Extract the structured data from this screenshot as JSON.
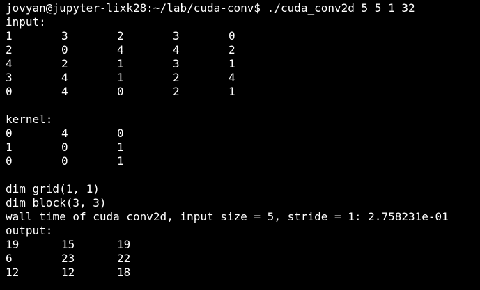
{
  "prompt": {
    "user_host_path": "jovyan@jupyter-lixk28:~/lab/cuda-conv$",
    "command": " ./cuda_conv2d 5 5 1 32"
  },
  "input": {
    "label": "input:",
    "rows": [
      [
        "1",
        "3",
        "2",
        "3",
        "0"
      ],
      [
        "2",
        "0",
        "4",
        "4",
        "2"
      ],
      [
        "4",
        "2",
        "1",
        "3",
        "1"
      ],
      [
        "3",
        "4",
        "1",
        "2",
        "4"
      ],
      [
        "0",
        "4",
        "0",
        "2",
        "1"
      ]
    ]
  },
  "kernel": {
    "label": "kernel:",
    "rows": [
      [
        "0",
        "4",
        "0"
      ],
      [
        "1",
        "0",
        "1"
      ],
      [
        "0",
        "0",
        "1"
      ]
    ]
  },
  "dims": {
    "grid": "dim_grid(1, 1)",
    "block": "dim_block(3, 3)"
  },
  "timing": {
    "text": "wall time of cuda_conv2d, input size = 5, stride = 1: 2.758231e-01"
  },
  "output": {
    "label": "output:",
    "rows": [
      [
        "19",
        "15",
        "19"
      ],
      [
        "6",
        "23",
        "22"
      ],
      [
        "12",
        "12",
        "18"
      ]
    ]
  },
  "colors": {
    "background": "#000000",
    "foreground": "#ffffff"
  }
}
